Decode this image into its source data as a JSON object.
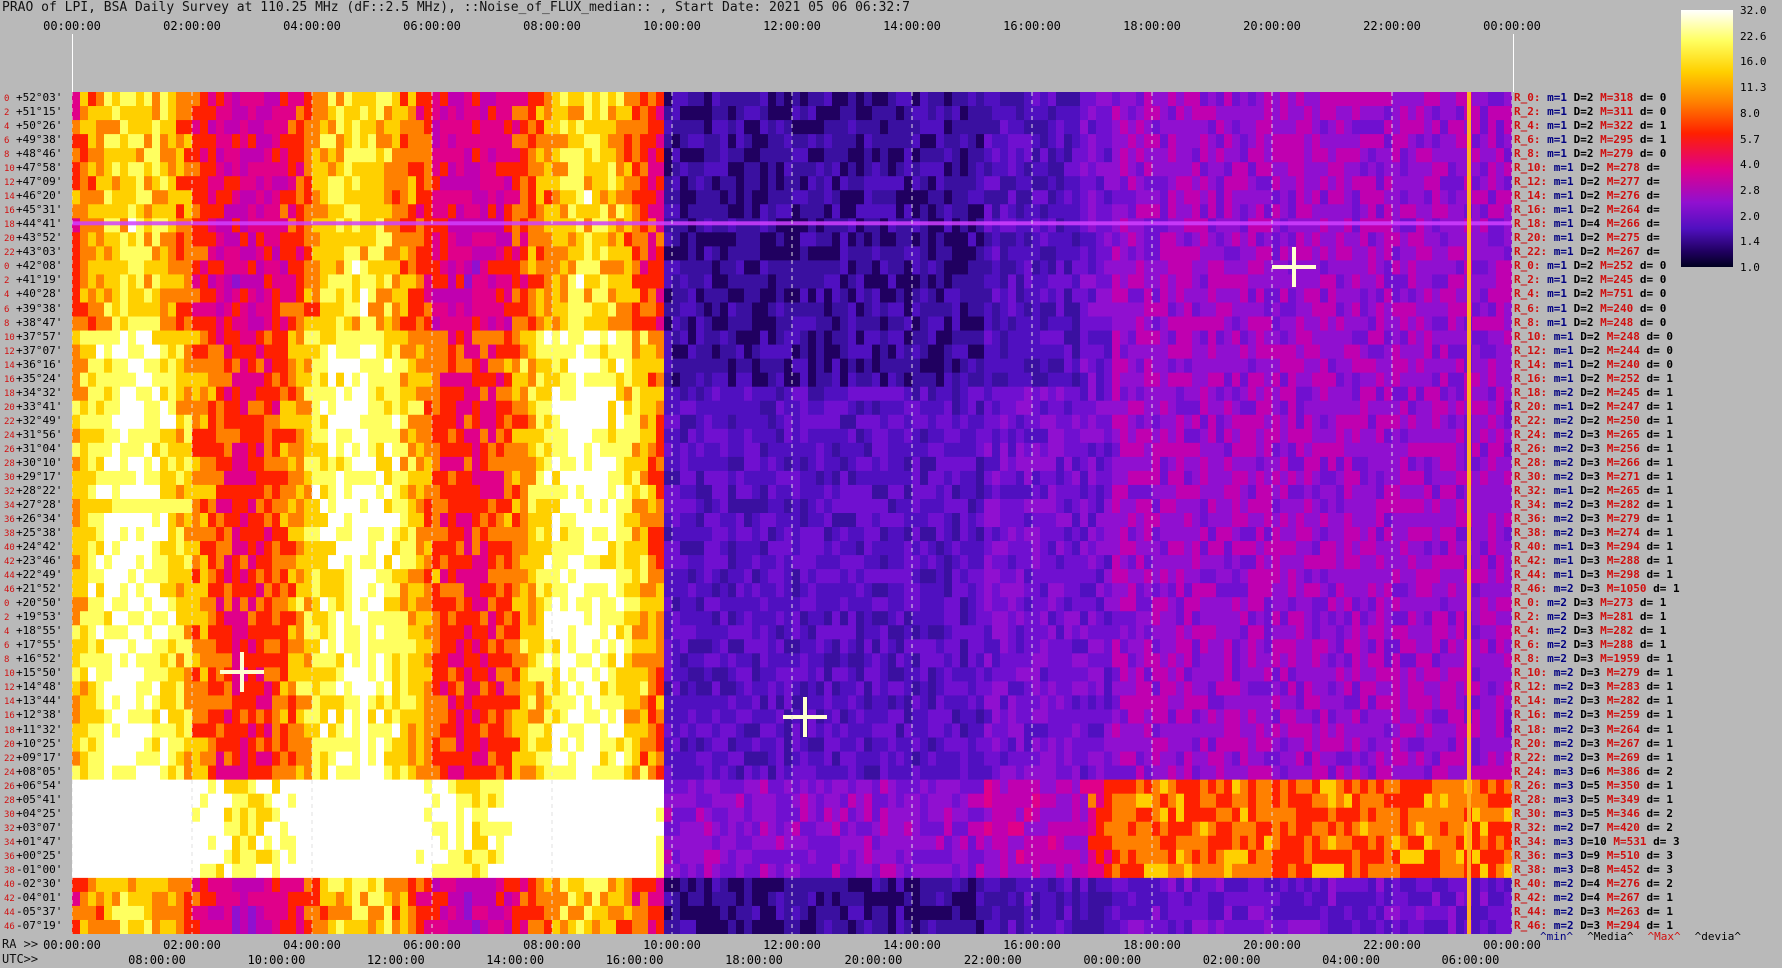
{
  "title": "PRAO of LPI, BSA Daily Survey at 110.25 MHz (dF::2.5 MHz), ::Noise_of_FLUX_median:: , Start Date: 2021 05 06 06:32:7",
  "chart_data": {
    "type": "heatmap",
    "title": "PRAO of LPI, BSA Daily Survey at 110.25 MHz (dF::2.5 MHz), ::Noise_of_FLUX_median:: , Start Date: 2021 05 06 06:32:7",
    "top_ticks": [
      "00:00:00",
      "02:00:00",
      "04:00:00",
      "06:00:00",
      "08:00:00",
      "10:00:00",
      "12:00:00",
      "14:00:00",
      "16:00:00",
      "18:00:00",
      "20:00:00",
      "22:00:00",
      "00:00:00"
    ],
    "ra_label": "RA >>",
    "ra_ticks": [
      "00:00:00",
      "02:00:00",
      "04:00:00",
      "06:00:00",
      "08:00:00",
      "10:00:00",
      "12:00:00",
      "14:00:00",
      "16:00:00",
      "18:00:00",
      "20:00:00",
      "22:00:00",
      "00:00:00"
    ],
    "utc_label": "UTC>>",
    "utc_ticks": [
      "08:00:00",
      "10:00:00",
      "12:00:00",
      "14:00:00",
      "16:00:00",
      "18:00:00",
      "20:00:00",
      "22:00:00",
      "00:00:00",
      "02:00:00",
      "04:00:00",
      "06:00:00"
    ],
    "colorbar_ticks": [
      "32.0",
      "22.6",
      "16.0",
      "11.3",
      "8.0",
      "5.7",
      "4.0",
      "2.8",
      "2.0",
      "1.4",
      "1.0"
    ],
    "declinations": [
      "+52°03'",
      "+51°15'",
      "+50°26'",
      "+49°38'",
      "+48°46'",
      "+47°58'",
      "+47°09'",
      "+46°20'",
      "+45°31'",
      "+44°41'",
      "+43°52'",
      "+43°03'",
      "+42°08'",
      "+41°19'",
      "+40°28'",
      "+39°38'",
      "+38°47'",
      "+37°57'",
      "+37°07'",
      "+36°16'",
      "+35°24'",
      "+34°32'",
      "+33°41'",
      "+32°49'",
      "+31°56'",
      "+31°04'",
      "+30°10'",
      "+29°17'",
      "+28°22'",
      "+27°28'",
      "+26°34'",
      "+25°38'",
      "+24°42'",
      "+23°46'",
      "+22°49'",
      "+21°52'",
      "+20°50'",
      "+19°53'",
      "+18°55'",
      "+17°55'",
      "+16°52'",
      "+15°50'",
      "+14°48'",
      "+13°44'",
      "+12°38'",
      "+11°32'",
      "+10°25'",
      "+09°17'",
      "+08°05'",
      "+06°54'",
      "+05°41'",
      "+04°25'",
      "+03°07'",
      "+01°47'",
      "+00°25'",
      "-01°00'",
      "-02°30'",
      "-04°01'",
      "-05°37'",
      "-07°19'"
    ],
    "row_index": [
      "0",
      "2",
      "4",
      "6",
      "8",
      "10",
      "12",
      "14",
      "16",
      "18",
      "20",
      "22",
      "0",
      "2",
      "4",
      "6",
      "8",
      "10",
      "12",
      "14",
      "16",
      "18",
      "20",
      "22",
      "24",
      "26",
      "28",
      "30",
      "32",
      "34",
      "36",
      "38",
      "40",
      "42",
      "44",
      "46",
      "0",
      "2",
      "4",
      "6",
      "8",
      "10",
      "12",
      "14",
      "16",
      "18",
      "20",
      "22",
      "24",
      "26",
      "28",
      "30",
      "32",
      "34",
      "36",
      "38",
      "40",
      "42",
      "44",
      "46"
    ],
    "stats": [
      {
        "r": "R_0:",
        "m": "m=1",
        "d": "D=2",
        "M": "M=318",
        "dv": "d= 0"
      },
      {
        "r": "R_2:",
        "m": "m=1",
        "d": "D=2",
        "M": "M=311",
        "dv": "d= 0"
      },
      {
        "r": "R_4:",
        "m": "m=1",
        "d": "D=2",
        "M": "M=322",
        "dv": "d= 1"
      },
      {
        "r": "R_6:",
        "m": "m=1",
        "d": "D=2",
        "M": "M=295",
        "dv": "d= 1"
      },
      {
        "r": "R_8:",
        "m": "m=1",
        "d": "D=2",
        "M": "M=279",
        "dv": "d= 0"
      },
      {
        "r": "R_10:",
        "m": "m=1",
        "d": "D=2",
        "M": "M=278",
        "dv": "d="
      },
      {
        "r": "R_12:",
        "m": "m=1",
        "d": "D=2",
        "M": "M=277",
        "dv": "d="
      },
      {
        "r": "R_14:",
        "m": "m=1",
        "d": "D=2",
        "M": "M=276",
        "dv": "d="
      },
      {
        "r": "R_16:",
        "m": "m=1",
        "d": "D=2",
        "M": "M=264",
        "dv": "d="
      },
      {
        "r": "R_18:",
        "m": "m=1",
        "d": "D=4",
        "M": "M=266",
        "dv": "d="
      },
      {
        "r": "R_20:",
        "m": "m=1",
        "d": "D=2",
        "M": "M=275",
        "dv": "d="
      },
      {
        "r": "R_22:",
        "m": "m=1",
        "d": "D=2",
        "M": "M=267",
        "dv": "d="
      },
      {
        "r": "R_0:",
        "m": "m=1",
        "d": "D=2",
        "M": "M=252",
        "dv": "d= 0"
      },
      {
        "r": "R_2:",
        "m": "m=1",
        "d": "D=2",
        "M": "M=245",
        "dv": "d= 0"
      },
      {
        "r": "R_4:",
        "m": "m=1",
        "d": "D=2",
        "M": "M=751",
        "dv": "d= 0"
      },
      {
        "r": "R_6:",
        "m": "m=1",
        "d": "D=2",
        "M": "M=240",
        "dv": "d= 0"
      },
      {
        "r": "R_8:",
        "m": "m=1",
        "d": "D=2",
        "M": "M=248",
        "dv": "d= 0"
      },
      {
        "r": "R_10:",
        "m": "m=1",
        "d": "D=2",
        "M": "M=248",
        "dv": "d= 0"
      },
      {
        "r": "R_12:",
        "m": "m=1",
        "d": "D=2",
        "M": "M=244",
        "dv": "d= 0"
      },
      {
        "r": "R_14:",
        "m": "m=1",
        "d": "D=2",
        "M": "M=240",
        "dv": "d= 0"
      },
      {
        "r": "R_16:",
        "m": "m=1",
        "d": "D=2",
        "M": "M=252",
        "dv": "d= 1"
      },
      {
        "r": "R_18:",
        "m": "m=2",
        "d": "D=2",
        "M": "M=245",
        "dv": "d= 1"
      },
      {
        "r": "R_20:",
        "m": "m=1",
        "d": "D=2",
        "M": "M=247",
        "dv": "d= 1"
      },
      {
        "r": "R_22:",
        "m": "m=2",
        "d": "D=2",
        "M": "M=250",
        "dv": "d= 1"
      },
      {
        "r": "R_24:",
        "m": "m=2",
        "d": "D=3",
        "M": "M=265",
        "dv": "d= 1"
      },
      {
        "r": "R_26:",
        "m": "m=2",
        "d": "D=3",
        "M": "M=256",
        "dv": "d= 1"
      },
      {
        "r": "R_28:",
        "m": "m=2",
        "d": "D=3",
        "M": "M=266",
        "dv": "d= 1"
      },
      {
        "r": "R_30:",
        "m": "m=2",
        "d": "D=3",
        "M": "M=271",
        "dv": "d= 1"
      },
      {
        "r": "R_32:",
        "m": "m=1",
        "d": "D=2",
        "M": "M=265",
        "dv": "d= 1"
      },
      {
        "r": "R_34:",
        "m": "m=2",
        "d": "D=3",
        "M": "M=282",
        "dv": "d= 1"
      },
      {
        "r": "R_36:",
        "m": "m=2",
        "d": "D=3",
        "M": "M=279",
        "dv": "d= 1"
      },
      {
        "r": "R_38:",
        "m": "m=2",
        "d": "D=3",
        "M": "M=274",
        "dv": "d= 1"
      },
      {
        "r": "R_40:",
        "m": "m=1",
        "d": "D=3",
        "M": "M=294",
        "dv": "d= 1"
      },
      {
        "r": "R_42:",
        "m": "m=1",
        "d": "D=3",
        "M": "M=288",
        "dv": "d= 1"
      },
      {
        "r": "R_44:",
        "m": "m=1",
        "d": "D=3",
        "M": "M=298",
        "dv": "d= 1"
      },
      {
        "r": "R_46:",
        "m": "m=2",
        "d": "D=3",
        "M": "M=1050",
        "dv": "d= 1"
      },
      {
        "r": "R_0:",
        "m": "m=2",
        "d": "D=3",
        "M": "M=273",
        "dv": "d= 1"
      },
      {
        "r": "R_2:",
        "m": "m=2",
        "d": "D=3",
        "M": "M=281",
        "dv": "d= 1"
      },
      {
        "r": "R_4:",
        "m": "m=2",
        "d": "D=3",
        "M": "M=282",
        "dv": "d= 1"
      },
      {
        "r": "R_6:",
        "m": "m=2",
        "d": "D=3",
        "M": "M=288",
        "dv": "d= 1"
      },
      {
        "r": "R_8:",
        "m": "m=2",
        "d": "D=3",
        "M": "M=1959",
        "dv": "d= 1"
      },
      {
        "r": "R_10:",
        "m": "m=2",
        "d": "D=3",
        "M": "M=279",
        "dv": "d= 1"
      },
      {
        "r": "R_12:",
        "m": "m=2",
        "d": "D=3",
        "M": "M=283",
        "dv": "d= 1"
      },
      {
        "r": "R_14:",
        "m": "m=2",
        "d": "D=3",
        "M": "M=282",
        "dv": "d= 1"
      },
      {
        "r": "R_16:",
        "m": "m=2",
        "d": "D=3",
        "M": "M=259",
        "dv": "d= 1"
      },
      {
        "r": "R_18:",
        "m": "m=2",
        "d": "D=3",
        "M": "M=264",
        "dv": "d= 1"
      },
      {
        "r": "R_20:",
        "m": "m=2",
        "d": "D=3",
        "M": "M=267",
        "dv": "d= 1"
      },
      {
        "r": "R_22:",
        "m": "m=2",
        "d": "D=3",
        "M": "M=269",
        "dv": "d= 1"
      },
      {
        "r": "R_24:",
        "m": "m=3",
        "d": "D=6",
        "M": "M=386",
        "dv": "d= 2"
      },
      {
        "r": "R_26:",
        "m": "m=3",
        "d": "D=5",
        "M": "M=350",
        "dv": "d= 1"
      },
      {
        "r": "R_28:",
        "m": "m=3",
        "d": "D=5",
        "M": "M=349",
        "dv": "d= 1"
      },
      {
        "r": "R_30:",
        "m": "m=3",
        "d": "D=5",
        "M": "M=346",
        "dv": "d= 2"
      },
      {
        "r": "R_32:",
        "m": "m=2",
        "d": "D=7",
        "M": "M=420",
        "dv": "d= 2"
      },
      {
        "r": "R_34:",
        "m": "m=3",
        "d": "D=10",
        "M": "M=531",
        "dv": "d= 3"
      },
      {
        "r": "R_36:",
        "m": "m=3",
        "d": "D=9",
        "M": "M=510",
        "dv": "d= 3"
      },
      {
        "r": "R_38:",
        "m": "m=3",
        "d": "D=8",
        "M": "M=452",
        "dv": "d= 3"
      },
      {
        "r": "R_40:",
        "m": "m=2",
        "d": "D=4",
        "M": "M=276",
        "dv": "d= 2"
      },
      {
        "r": "R_42:",
        "m": "m=2",
        "d": "D=4",
        "M": "M=267",
        "dv": "d= 1"
      },
      {
        "r": "R_44:",
        "m": "m=2",
        "d": "D=3",
        "M": "M=263",
        "dv": "d= 1"
      },
      {
        "r": "R_46:",
        "m": "m=2",
        "d": "D=3",
        "M": "M=294",
        "dv": "d= 1"
      }
    ],
    "footer_legend": [
      "^min^",
      "^Media^",
      "^Max^",
      "^devia^"
    ]
  },
  "colors": {
    "background": "#b9b9b9",
    "accent_red": "#d01010",
    "accent_navy": "#000080"
  }
}
